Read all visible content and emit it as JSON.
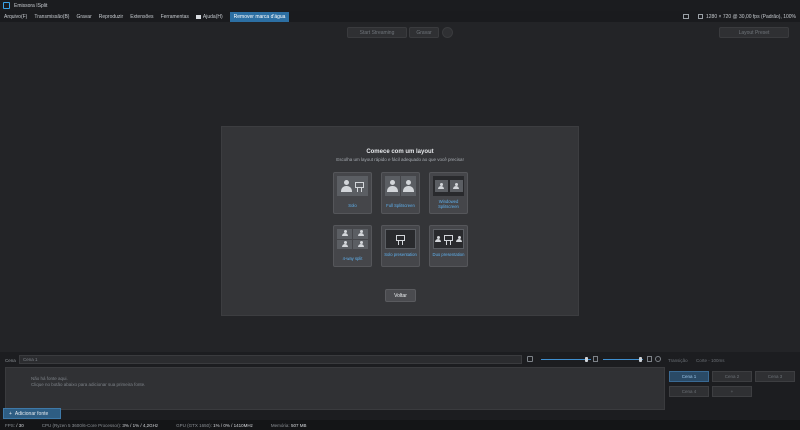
{
  "window": {
    "title": "Emissora ISplit"
  },
  "menu": {
    "items": [
      "Arquivo(F)",
      "Transmissão(B)",
      "Gravar",
      "Reproduzir",
      "Extensões",
      "Ferramentas"
    ],
    "help": "Ajuda(H)",
    "watermark": "Remover marca d'água",
    "resolution": "1280 × 720 @ 30,00 fps (Padrão), 100%"
  },
  "toolbar": {
    "start": "Start Streaming",
    "record": "Gravar",
    "layout": "Layout Preset"
  },
  "dialog": {
    "title": "Comece com um layout",
    "subtitle": "Escolha um layout rápido e fácil adequado ao que você precisa!",
    "cards": [
      {
        "label": "Solo"
      },
      {
        "label": "Full Splitscreen"
      },
      {
        "label": "Windowed Splitscreen"
      },
      {
        "label": "4-way split"
      },
      {
        "label": "Solo presentation"
      },
      {
        "label": "Duo presentation"
      }
    ],
    "back_button": "Voltar"
  },
  "bottom": {
    "source_label": "Cena",
    "source_value": "Cena 1",
    "transition_label": "Transição",
    "transition_value": "Corte - 100ms",
    "no_sources_line1": "Não há fonte aqui.",
    "no_sources_line2": "Clique no botão abaixo para adicionar sua primeira fonte.",
    "add_source": "Adicionar fonte",
    "scenes": [
      "Cena 1",
      "Cena 2",
      "Cena 3",
      "Cena 4",
      "+"
    ]
  },
  "status": {
    "fps_label": "FPS:",
    "fps_value": "/ 30",
    "cpu_label": "CPU (Ryzen 5 3600/6-Core Processor):",
    "cpu_value": "3% / 1% / 4,2GHz",
    "gpu_label": "GPU (GTX 1650):",
    "gpu_value": "1% / 0% / 1410MHz",
    "mem_label": "Memória:",
    "mem_value": "507 MB"
  },
  "colors": {
    "accent": "#3aa3e8",
    "highlight": "#2c6fa3",
    "card_label": "#5fb1ef"
  }
}
